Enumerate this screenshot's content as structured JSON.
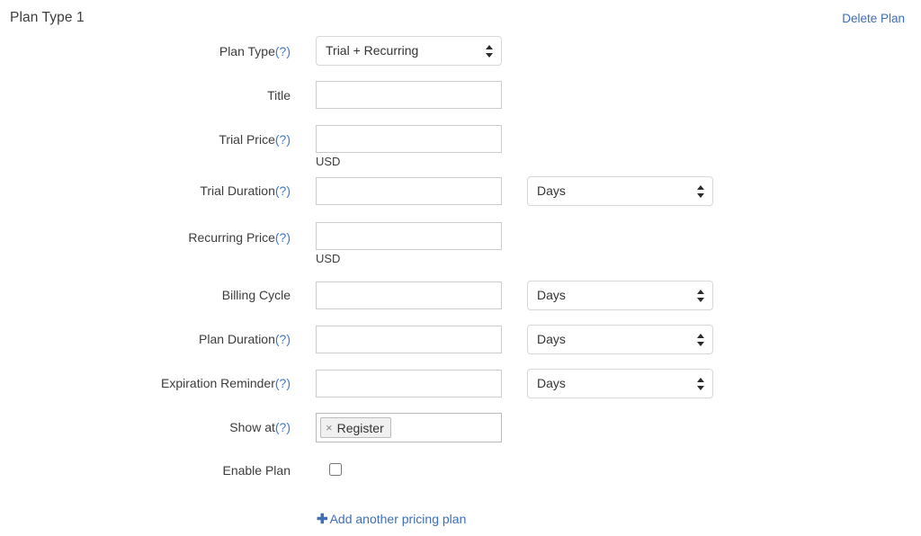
{
  "header": {
    "plan_title": "Plan Type 1",
    "delete_link": "Delete Plan"
  },
  "rows": {
    "plan_type": {
      "label": "Plan Type",
      "help": "(?)",
      "value": "Trial + Recurring"
    },
    "title": {
      "label": "Title",
      "value": "",
      "placeholder": ""
    },
    "trial_price": {
      "label": "Trial Price",
      "help": "(?)",
      "value": "",
      "unit": "USD"
    },
    "trial_duration": {
      "label": "Trial Duration",
      "help": "(?)",
      "value": "",
      "unit_select": "Days"
    },
    "recurring_price": {
      "label": "Recurring Price",
      "help": "(?)",
      "value": "",
      "unit": "USD"
    },
    "billing_cycle": {
      "label": "Billing Cycle",
      "value": "",
      "unit_select": "Days"
    },
    "plan_duration": {
      "label": "Plan Duration",
      "help": "(?)",
      "value": "",
      "unit_select": "Days"
    },
    "expiration_reminder": {
      "label": "Expiration Reminder",
      "help": "(?)",
      "value": "",
      "unit_select": "Days"
    },
    "show_at": {
      "label": "Show at",
      "help": "(?)",
      "tag": "Register",
      "tag_remove": "×"
    },
    "enable_plan": {
      "label": "Enable Plan",
      "checked": false
    }
  },
  "footer": {
    "add_plan_plus": "✚",
    "add_plan_label": "Add another pricing plan"
  },
  "colors": {
    "link": "#3f6fb5",
    "help": "#4277c0",
    "text": "#3c3c3c",
    "border": "#cccccc",
    "background": "#ffffff"
  }
}
